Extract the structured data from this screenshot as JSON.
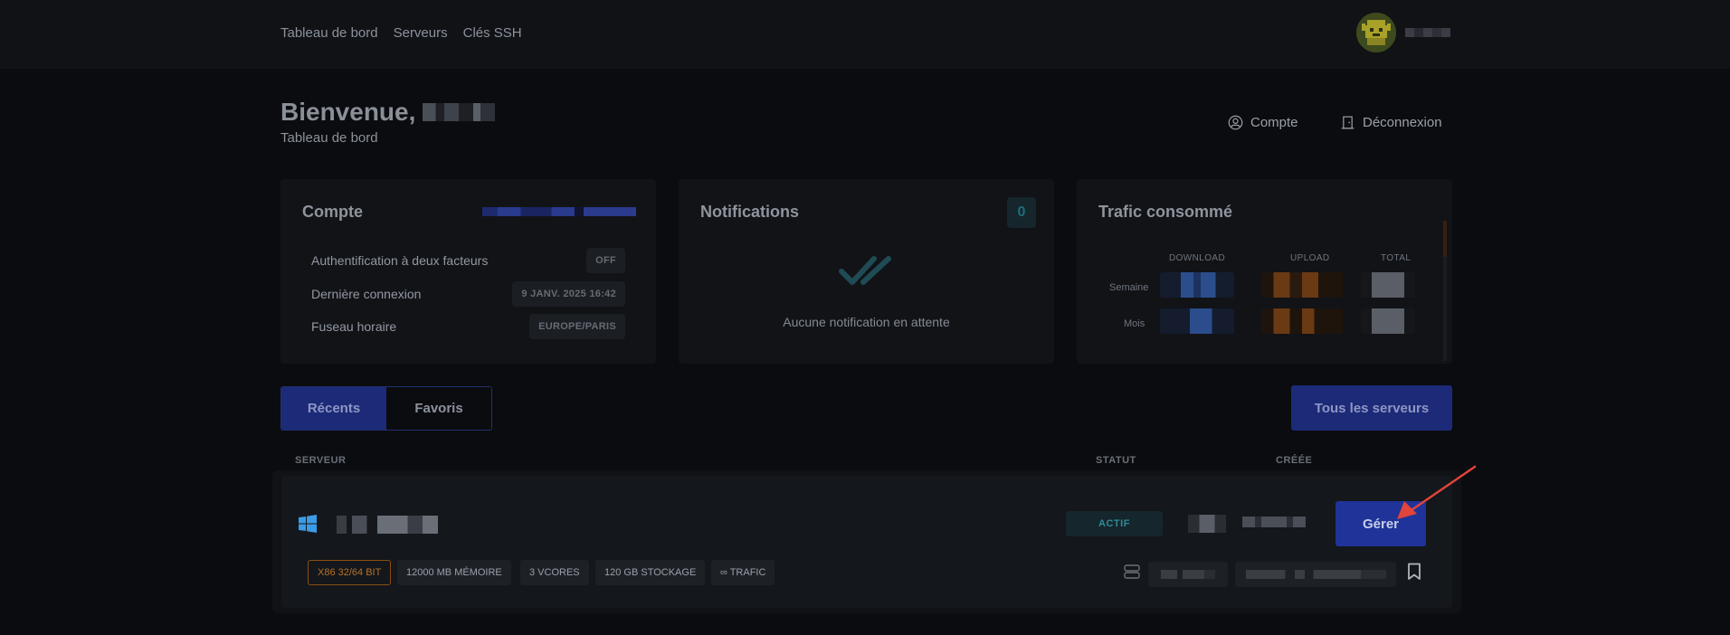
{
  "nav": {
    "items": [
      "Tableau de bord",
      "Serveurs",
      "Clés SSH"
    ]
  },
  "welcome": {
    "greeting": "Bienvenue,",
    "subtitle": "Tableau de bord"
  },
  "actions": {
    "account_label": "Compte",
    "logout_label": "Déconnexion"
  },
  "account_card": {
    "title": "Compte",
    "rows": [
      {
        "label": "Authentification à deux facteurs",
        "value": "OFF"
      },
      {
        "label": "Dernière connexion",
        "value": "9 JANV. 2025 16:42"
      },
      {
        "label": "Fuseau horaire",
        "value": "EUROPE/PARIS"
      }
    ]
  },
  "notifications_card": {
    "title": "Notifications",
    "count": "0",
    "empty_text": "Aucune notification en attente"
  },
  "traffic_card": {
    "title": "Trafic consommé",
    "columns": [
      "DOWNLOAD",
      "UPLOAD",
      "TOTAL"
    ],
    "rows": [
      "Semaine",
      "Mois"
    ]
  },
  "tabs": [
    {
      "label": "Récents",
      "active": true
    },
    {
      "label": "Favoris",
      "active": false
    }
  ],
  "all_servers_label": "Tous les serveurs",
  "table_headers": {
    "server": "SERVEUR",
    "status": "STATUT",
    "created": "CRÉÉE"
  },
  "server": {
    "os_icon": "windows-icon",
    "status": "ACTIF",
    "manage_label": "Gérer",
    "specs": [
      "X86 32/64 BIT",
      "12000 MB MÉMOIRE",
      "3 VCORES",
      "120 GB STOCKAGE",
      "∞ TRAFIC"
    ]
  },
  "colors": {
    "accent": "#1f3399",
    "status_active": "#2f8a98",
    "arch_orange": "#b9712a",
    "arrow_red": "#e0443a"
  }
}
